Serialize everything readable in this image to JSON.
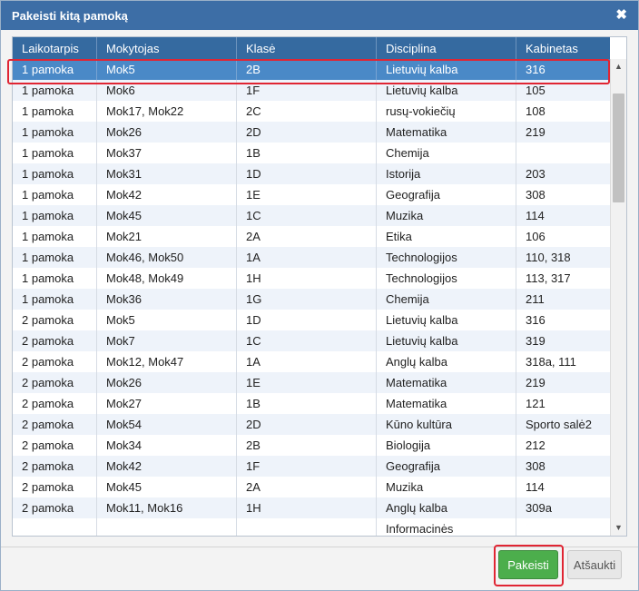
{
  "dialog": {
    "title": "Pakeisti kitą pamoką",
    "close_glyph": "✖"
  },
  "table": {
    "columns": [
      "Laikotarpis",
      "Mokytojas",
      "Klasė",
      "Disciplina",
      "Kabinetas"
    ],
    "rows": [
      [
        "1 pamoka",
        "Mok5",
        "2B",
        "Lietuvių kalba",
        "316"
      ],
      [
        "1 pamoka",
        "Mok6",
        "1F",
        "Lietuvių kalba",
        "105"
      ],
      [
        "1 pamoka",
        "Mok17, Mok22",
        "2C",
        "rusų-vokiečių",
        "108"
      ],
      [
        "1 pamoka",
        "Mok26",
        "2D",
        "Matematika",
        "219"
      ],
      [
        "1 pamoka",
        "Mok37",
        "1B",
        "Chemija",
        ""
      ],
      [
        "1 pamoka",
        "Mok31",
        "1D",
        "Istorija",
        "203"
      ],
      [
        "1 pamoka",
        "Mok42",
        "1E",
        "Geografija",
        "308"
      ],
      [
        "1 pamoka",
        "Mok45",
        "1C",
        "Muzika",
        "114"
      ],
      [
        "1 pamoka",
        "Mok21",
        "2A",
        "Etika",
        "106"
      ],
      [
        "1 pamoka",
        "Mok46, Mok50",
        "1A",
        "Technologijos",
        "110, 318"
      ],
      [
        "1 pamoka",
        "Mok48, Mok49",
        "1H",
        "Technologijos",
        "113, 317"
      ],
      [
        "1 pamoka",
        "Mok36",
        "1G",
        "Chemija",
        "211"
      ],
      [
        "2 pamoka",
        "Mok5",
        "1D",
        "Lietuvių kalba",
        "316"
      ],
      [
        "2 pamoka",
        "Mok7",
        "1C",
        "Lietuvių kalba",
        "319"
      ],
      [
        "2 pamoka",
        "Mok12, Mok47",
        "1A",
        "Anglų kalba",
        "318a, 111"
      ],
      [
        "2 pamoka",
        "Mok26",
        "1E",
        "Matematika",
        "219"
      ],
      [
        "2 pamoka",
        "Mok27",
        "1B",
        "Matematika",
        "121"
      ],
      [
        "2 pamoka",
        "Mok54",
        "2D",
        "Kūno kultūra",
        "Sporto salė2"
      ],
      [
        "2 pamoka",
        "Mok34",
        "2B",
        "Biologija",
        "212"
      ],
      [
        "2 pamoka",
        "Mok42",
        "1F",
        "Geografija",
        "308"
      ],
      [
        "2 pamoka",
        "Mok45",
        "2A",
        "Muzika",
        "114"
      ],
      [
        "2 pamoka",
        "Mok11, Mok16",
        "1H",
        "Anglų kalba",
        "309a"
      ],
      [
        "",
        "",
        "",
        "Informacinės",
        ""
      ]
    ],
    "selected_row": 0
  },
  "scrollbar": {
    "up_glyph": "▲",
    "down_glyph": "▼"
  },
  "footer": {
    "confirm_label": "Pakeisti",
    "cancel_label": "Atšaukti"
  },
  "colors": {
    "titlebar": "#3d6ea6",
    "header": "#356aa0",
    "selected_row": "#4a89c7",
    "confirm_button": "#4cae4c",
    "highlight": "#e02533"
  }
}
